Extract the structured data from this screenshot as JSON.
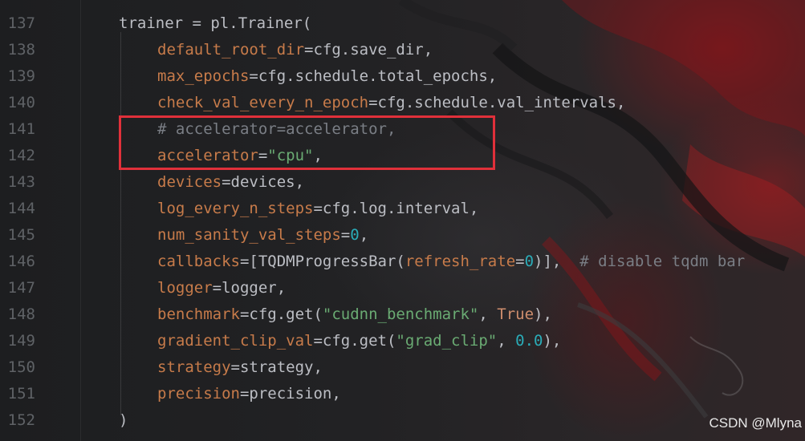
{
  "editor": {
    "lines": [
      {
        "num": "137",
        "indent": 0,
        "parts": [
          {
            "t": "tx",
            "v": "trainer = pl.Trainer("
          }
        ]
      },
      {
        "num": "138",
        "indent": 1,
        "parts": [
          {
            "t": "kw",
            "v": "default_root_dir"
          },
          {
            "t": "tx",
            "v": "=cfg.save_dir,"
          }
        ]
      },
      {
        "num": "139",
        "indent": 1,
        "parts": [
          {
            "t": "kw",
            "v": "max_epochs"
          },
          {
            "t": "tx",
            "v": "=cfg.schedule.total_epochs,"
          }
        ]
      },
      {
        "num": "140",
        "indent": 1,
        "parts": [
          {
            "t": "kw",
            "v": "check_val_every_n_epoch"
          },
          {
            "t": "tx",
            "v": "=cfg.schedule.val_intervals,"
          }
        ]
      },
      {
        "num": "141",
        "indent": 1,
        "parts": [
          {
            "t": "cm",
            "v": "# accelerator=accelerator,"
          }
        ]
      },
      {
        "num": "142",
        "indent": 1,
        "parts": [
          {
            "t": "kw",
            "v": "accelerator"
          },
          {
            "t": "tx",
            "v": "="
          },
          {
            "t": "str",
            "v": "\"cpu\""
          },
          {
            "t": "tx",
            "v": ","
          }
        ]
      },
      {
        "num": "143",
        "indent": 1,
        "parts": [
          {
            "t": "kw",
            "v": "devices"
          },
          {
            "t": "tx",
            "v": "=devices,"
          }
        ]
      },
      {
        "num": "144",
        "indent": 1,
        "parts": [
          {
            "t": "kw",
            "v": "log_every_n_steps"
          },
          {
            "t": "tx",
            "v": "=cfg.log.interval,"
          }
        ]
      },
      {
        "num": "145",
        "indent": 1,
        "parts": [
          {
            "t": "kw",
            "v": "num_sanity_val_steps"
          },
          {
            "t": "tx",
            "v": "="
          },
          {
            "t": "num",
            "v": "0"
          },
          {
            "t": "tx",
            "v": ","
          }
        ]
      },
      {
        "num": "146",
        "indent": 1,
        "parts": [
          {
            "t": "kw",
            "v": "callbacks"
          },
          {
            "t": "tx",
            "v": "=[TQDMProgressBar("
          },
          {
            "t": "kw",
            "v": "refresh_rate"
          },
          {
            "t": "tx",
            "v": "="
          },
          {
            "t": "num",
            "v": "0"
          },
          {
            "t": "tx",
            "v": ")],  "
          },
          {
            "t": "cm",
            "v": "# disable tqdm bar"
          }
        ]
      },
      {
        "num": "147",
        "indent": 1,
        "parts": [
          {
            "t": "kw",
            "v": "logger"
          },
          {
            "t": "tx",
            "v": "=logger,"
          }
        ]
      },
      {
        "num": "148",
        "indent": 1,
        "parts": [
          {
            "t": "kw",
            "v": "benchmark"
          },
          {
            "t": "tx",
            "v": "=cfg.get("
          },
          {
            "t": "str",
            "v": "\"cudnn_benchmark\""
          },
          {
            "t": "tx",
            "v": ", "
          },
          {
            "t": "kwl",
            "v": "True"
          },
          {
            "t": "tx",
            "v": "),"
          }
        ]
      },
      {
        "num": "149",
        "indent": 1,
        "parts": [
          {
            "t": "kw",
            "v": "gradient_clip_val"
          },
          {
            "t": "tx",
            "v": "=cfg.get("
          },
          {
            "t": "str",
            "v": "\"grad_clip\""
          },
          {
            "t": "tx",
            "v": ", "
          },
          {
            "t": "num",
            "v": "0.0"
          },
          {
            "t": "tx",
            "v": "),"
          }
        ]
      },
      {
        "num": "150",
        "indent": 1,
        "parts": [
          {
            "t": "kw",
            "v": "strategy"
          },
          {
            "t": "tx",
            "v": "=strategy,"
          }
        ]
      },
      {
        "num": "151",
        "indent": 1,
        "parts": [
          {
            "t": "kw",
            "v": "precision"
          },
          {
            "t": "tx",
            "v": "=precision,"
          }
        ]
      },
      {
        "num": "152",
        "indent": 0,
        "parts": [
          {
            "t": "tx",
            "v": ")"
          }
        ]
      }
    ]
  },
  "watermark": "CSDN @Mlyna",
  "colors": {
    "keyword_arg": "#c77b4a",
    "text": "#bcbec4",
    "string": "#6aab73",
    "number": "#2aacb8",
    "comment": "#7a7e85",
    "highlight_box": "#e0303a"
  }
}
